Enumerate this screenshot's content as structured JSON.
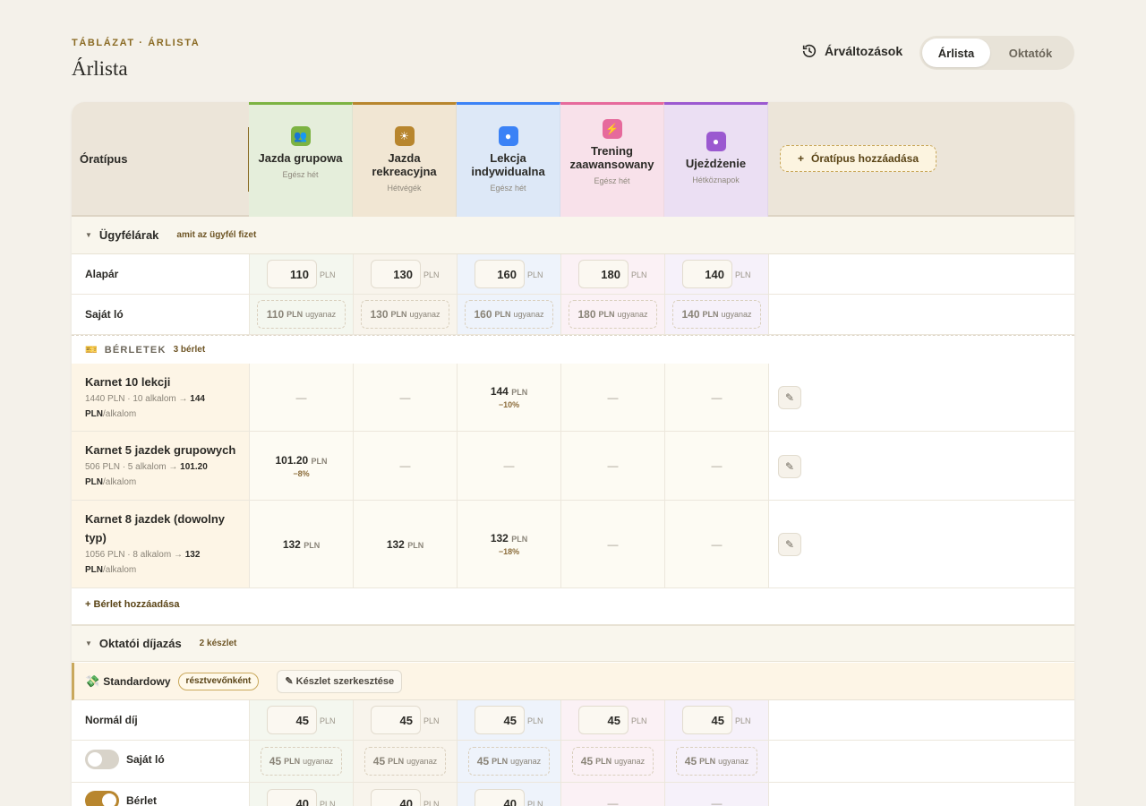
{
  "header": {
    "eyebrow": "TÁBLÁZAT · ÁRLISTA",
    "title": "Árlista",
    "history_label": "Árváltozások",
    "segments": [
      "Árlista",
      "Oktatók"
    ],
    "active_segment": "Árlista"
  },
  "table": {
    "row_header": "Óratípus",
    "add_column_label": "Óratípus hozzáadása",
    "columns": [
      {
        "name": "Jazda grupowa",
        "schedule": "Egész hét",
        "icon": "users-icon",
        "color": "#7cb342",
        "bg": "#e5eedb"
      },
      {
        "name": "Jazda rekreacyjna",
        "schedule": "Hétvégék",
        "icon": "sun-icon",
        "color": "#b8862e",
        "bg": "#f1e6d3"
      },
      {
        "name": "Lekcja indywidualna",
        "schedule": "Egész hét",
        "icon": "circle-icon",
        "color": "#3b82f6",
        "bg": "#dde8f7"
      },
      {
        "name": "Trening zaawansowany",
        "schedule": "Egész hét",
        "icon": "bolt-icon",
        "color": "#e66a9c",
        "bg": "#f8e1ea"
      },
      {
        "name": "Ujeżdżenie",
        "schedule": "Hétköznapok",
        "icon": "circle-icon",
        "color": "#9b59d0",
        "bg": "#ebdff3"
      }
    ]
  },
  "client_prices": {
    "title": "Ügyfélárak",
    "note": "amit az ügyfél fizet",
    "base_label": "Alapár",
    "base_values": [
      "110",
      "130",
      "160",
      "180",
      "140"
    ],
    "own_horse_label": "Saját ló",
    "own_horse_values": [
      "110",
      "130",
      "160",
      "180",
      "140"
    ],
    "unit": "PLN",
    "same_label": "ugyanaz"
  },
  "passes": {
    "title": "BÉRLETEK",
    "count": "3 bérlet",
    "add_label": "Bérlet hozzáadása",
    "items": [
      {
        "name": "Karnet 10 lekcji",
        "desc": "1440 PLN · 10 alkalom →",
        "per": "144 PLN",
        "per_suffix": "/alkalom",
        "cells": [
          {
            "value": "—"
          },
          {
            "value": "—"
          },
          {
            "value": "144",
            "unit": "PLN",
            "discount": "−10%"
          },
          {
            "value": "—"
          },
          {
            "value": "—"
          }
        ]
      },
      {
        "name": "Karnet 5 jazdek grupowych",
        "desc": "506 PLN · 5 alkalom →",
        "per": "101.20 PLN",
        "per_suffix": "/alkalom",
        "cells": [
          {
            "value": "101.20",
            "unit": "PLN",
            "discount": "−8%"
          },
          {
            "value": "—"
          },
          {
            "value": "—"
          },
          {
            "value": "—"
          },
          {
            "value": "—"
          }
        ]
      },
      {
        "name": "Karnet 8 jazdek (dowolny typ)",
        "desc": "1056 PLN · 8 alkalom →",
        "per": "132 PLN",
        "per_suffix": "/alkalom",
        "cells": [
          {
            "value": "132",
            "unit": "PLN"
          },
          {
            "value": "132",
            "unit": "PLN"
          },
          {
            "value": "132",
            "unit": "PLN",
            "discount": "−18%"
          },
          {
            "value": "—"
          },
          {
            "value": "—"
          }
        ]
      }
    ]
  },
  "instructor": {
    "title": "Oktatói díjazás",
    "note": "2 készlet",
    "set_name": "Standardowy",
    "set_badge": "résztvevőnként",
    "edit_set_label": "Készlet szerkesztése",
    "normal_label": "Normál díj",
    "normal_values": [
      "45",
      "45",
      "45",
      "45",
      "45"
    ],
    "own_horse_label": "Saját ló",
    "own_horse_on": false,
    "own_horse_values": [
      "45",
      "45",
      "45",
      "45",
      "45"
    ],
    "pass_label": "Bérlet",
    "pass_on": true,
    "pass_values": [
      "40",
      "40",
      "40",
      "—",
      "—"
    ]
  }
}
